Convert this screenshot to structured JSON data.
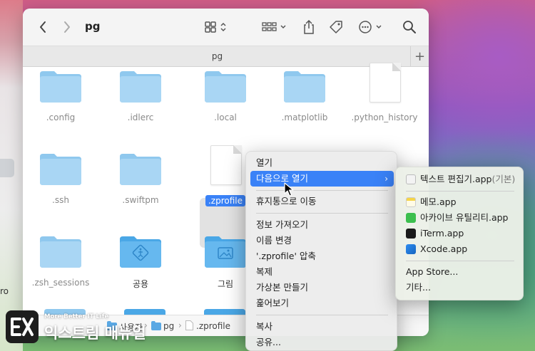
{
  "window": {
    "title": "pg",
    "tab_title": "pg",
    "tab_add": "+"
  },
  "toolbar": {
    "icons": [
      "chevron-left-icon",
      "chevron-right-icon",
      "grid-view-icon",
      "group-icon",
      "share-icon",
      "tag-icon",
      "more-icon",
      "search-icon"
    ]
  },
  "items": [
    {
      "label": ".config",
      "kind": "folder"
    },
    {
      "label": ".idlerc",
      "kind": "folder"
    },
    {
      "label": ".local",
      "kind": "folder"
    },
    {
      "label": ".matplotlib",
      "kind": "folder"
    },
    {
      "label": ".python_history",
      "kind": "document"
    },
    {
      "label": ".ssh",
      "kind": "folder"
    },
    {
      "label": ".swiftpm",
      "kind": "folder"
    },
    {
      "label": ".zprofile",
      "kind": "document",
      "selected": true
    },
    {
      "label": ".zsh_sessions",
      "kind": "folder"
    },
    {
      "label": "공용",
      "kind": "folder",
      "icon": "accessibility-icon"
    },
    {
      "label": "그림",
      "kind": "folder",
      "icon": "picture-icon"
    }
  ],
  "pathbar": {
    "items": [
      "사용자",
      "pg",
      ".zprofile"
    ]
  },
  "context_menu": {
    "items": [
      "열기",
      "다음으로 열기",
      "휴지통으로 이동",
      "정보 가져오기",
      "이름 변경",
      "'.zprofile' 압축",
      "복제",
      "가상본 만들기",
      "훑어보기",
      "복사",
      "공유..."
    ],
    "submenu_arrow": "›"
  },
  "submenu": {
    "default_app": "텍스트 편집기.app",
    "default_suffix": "(기본)",
    "apps": [
      "메모.app",
      "아카이브 유틸리티.app",
      "iTerm.app",
      "Xcode.app"
    ],
    "app_store": "App Store...",
    "other": "기타..."
  },
  "desktop": {
    "partial_label": "ro"
  },
  "watermark": {
    "tagline": "More Better IT Life",
    "name": "익스트림 매뉴얼",
    "logo_text": "EX"
  },
  "colors": {
    "accent": "#3a82f7",
    "folder": "#a6d4f2",
    "folder_dark": "#66b6ea"
  }
}
